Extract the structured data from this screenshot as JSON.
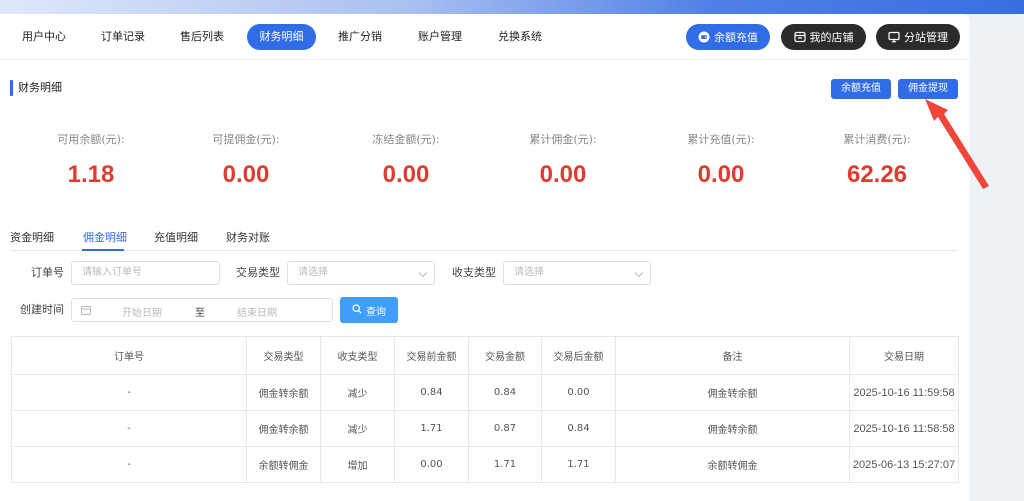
{
  "nav": {
    "tabs": [
      {
        "label": "用户中心"
      },
      {
        "label": "订单记录"
      },
      {
        "label": "售后列表"
      },
      {
        "label": "财务明细"
      },
      {
        "label": "推广分销"
      },
      {
        "label": "账户管理"
      },
      {
        "label": "兑换系统"
      }
    ],
    "active_tab": "财务明细",
    "actions": [
      {
        "label": "余额充值",
        "icon": "wallet-icon"
      },
      {
        "label": "我的店铺",
        "icon": "store-icon"
      },
      {
        "label": "分站管理",
        "icon": "monitor-icon"
      }
    ]
  },
  "section": {
    "title": "财务明细",
    "recharge_label": "余额充值",
    "withdraw_label": "佣金提现"
  },
  "stats": [
    {
      "label": "可用余额(元):",
      "value": "1.18"
    },
    {
      "label": "可提佣金(元):",
      "value": "0.00"
    },
    {
      "label": "冻结金额(元):",
      "value": "0.00"
    },
    {
      "label": "累计佣金(元):",
      "value": "0.00"
    },
    {
      "label": "累计充值(元):",
      "value": "0.00"
    },
    {
      "label": "累计消费(元):",
      "value": "62.26"
    }
  ],
  "sub_tabs": [
    "资金明细",
    "佣金明细",
    "充值明细",
    "财务对账"
  ],
  "active_sub_tab": "佣金明细",
  "filters": {
    "order_no_label": "订单号",
    "order_no_placeholder": "请输入订单号",
    "trade_type_label": "交易类型",
    "trade_type_placeholder": "请选择",
    "inout_type_label": "收支类型",
    "inout_type_placeholder": "请选择",
    "created_label": "创建时间",
    "start_placeholder": "开始日期",
    "range_sep": "至",
    "end_placeholder": "结束日期",
    "query_label": "查询"
  },
  "table": {
    "headers": [
      "订单号",
      "交易类型",
      "收支类型",
      "交易前金额",
      "交易金额",
      "交易后金额",
      "备注",
      "交易日期"
    ],
    "rows": [
      [
        "-",
        "佣金转余额",
        "减少",
        "0.84",
        "0.84",
        "0.00",
        "佣金转余额",
        "2025-10-16 11:59:58"
      ],
      [
        "-",
        "佣金转余额",
        "减少",
        "1.71",
        "0.87",
        "0.84",
        "佣金转余额",
        "2025-10-16 11:58:58"
      ],
      [
        "-",
        "余额转佣金",
        "增加",
        "0.00",
        "1.71",
        "1.71",
        "余额转佣金",
        "2025-06-13 15:27:07"
      ]
    ]
  },
  "colors": {
    "accent": "#2f6ce6",
    "dark_button": "#2b2b2b",
    "stat_value": "#e03b2f",
    "annotation_arrow": "#f0453a"
  }
}
